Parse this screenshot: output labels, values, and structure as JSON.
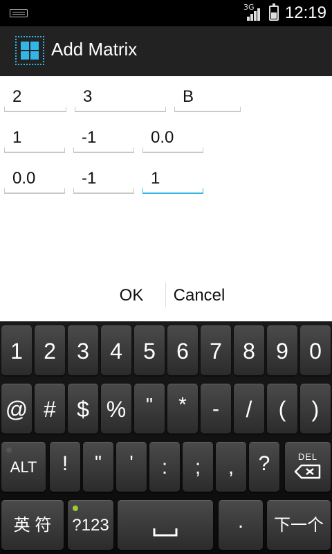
{
  "status_bar": {
    "network": "3G",
    "time": "12:19"
  },
  "title_bar": {
    "title": "Add Matrix"
  },
  "form": {
    "row1": [
      "2",
      "3",
      "B"
    ],
    "row2": [
      "1",
      "-1",
      "0.0"
    ],
    "row3": [
      "0.0",
      "-1",
      "1"
    ]
  },
  "buttons": {
    "ok": "OK",
    "cancel": "Cancel"
  },
  "keyboard": {
    "row1": [
      "1",
      "2",
      "3",
      "4",
      "5",
      "6",
      "7",
      "8",
      "9",
      "0"
    ],
    "row2": [
      "@",
      "#",
      "$",
      "%",
      "\"",
      "*",
      "-",
      "/",
      "(",
      ")"
    ],
    "row3": [
      "ALT",
      "!",
      "\"",
      "'",
      ":",
      ";",
      ",",
      "?",
      "DEL"
    ],
    "row4": [
      "英 符",
      "?123",
      "␣",
      ".",
      "下一个"
    ]
  },
  "colors": {
    "accent": "#33b5e5",
    "indicator_green": "#9acd32"
  }
}
